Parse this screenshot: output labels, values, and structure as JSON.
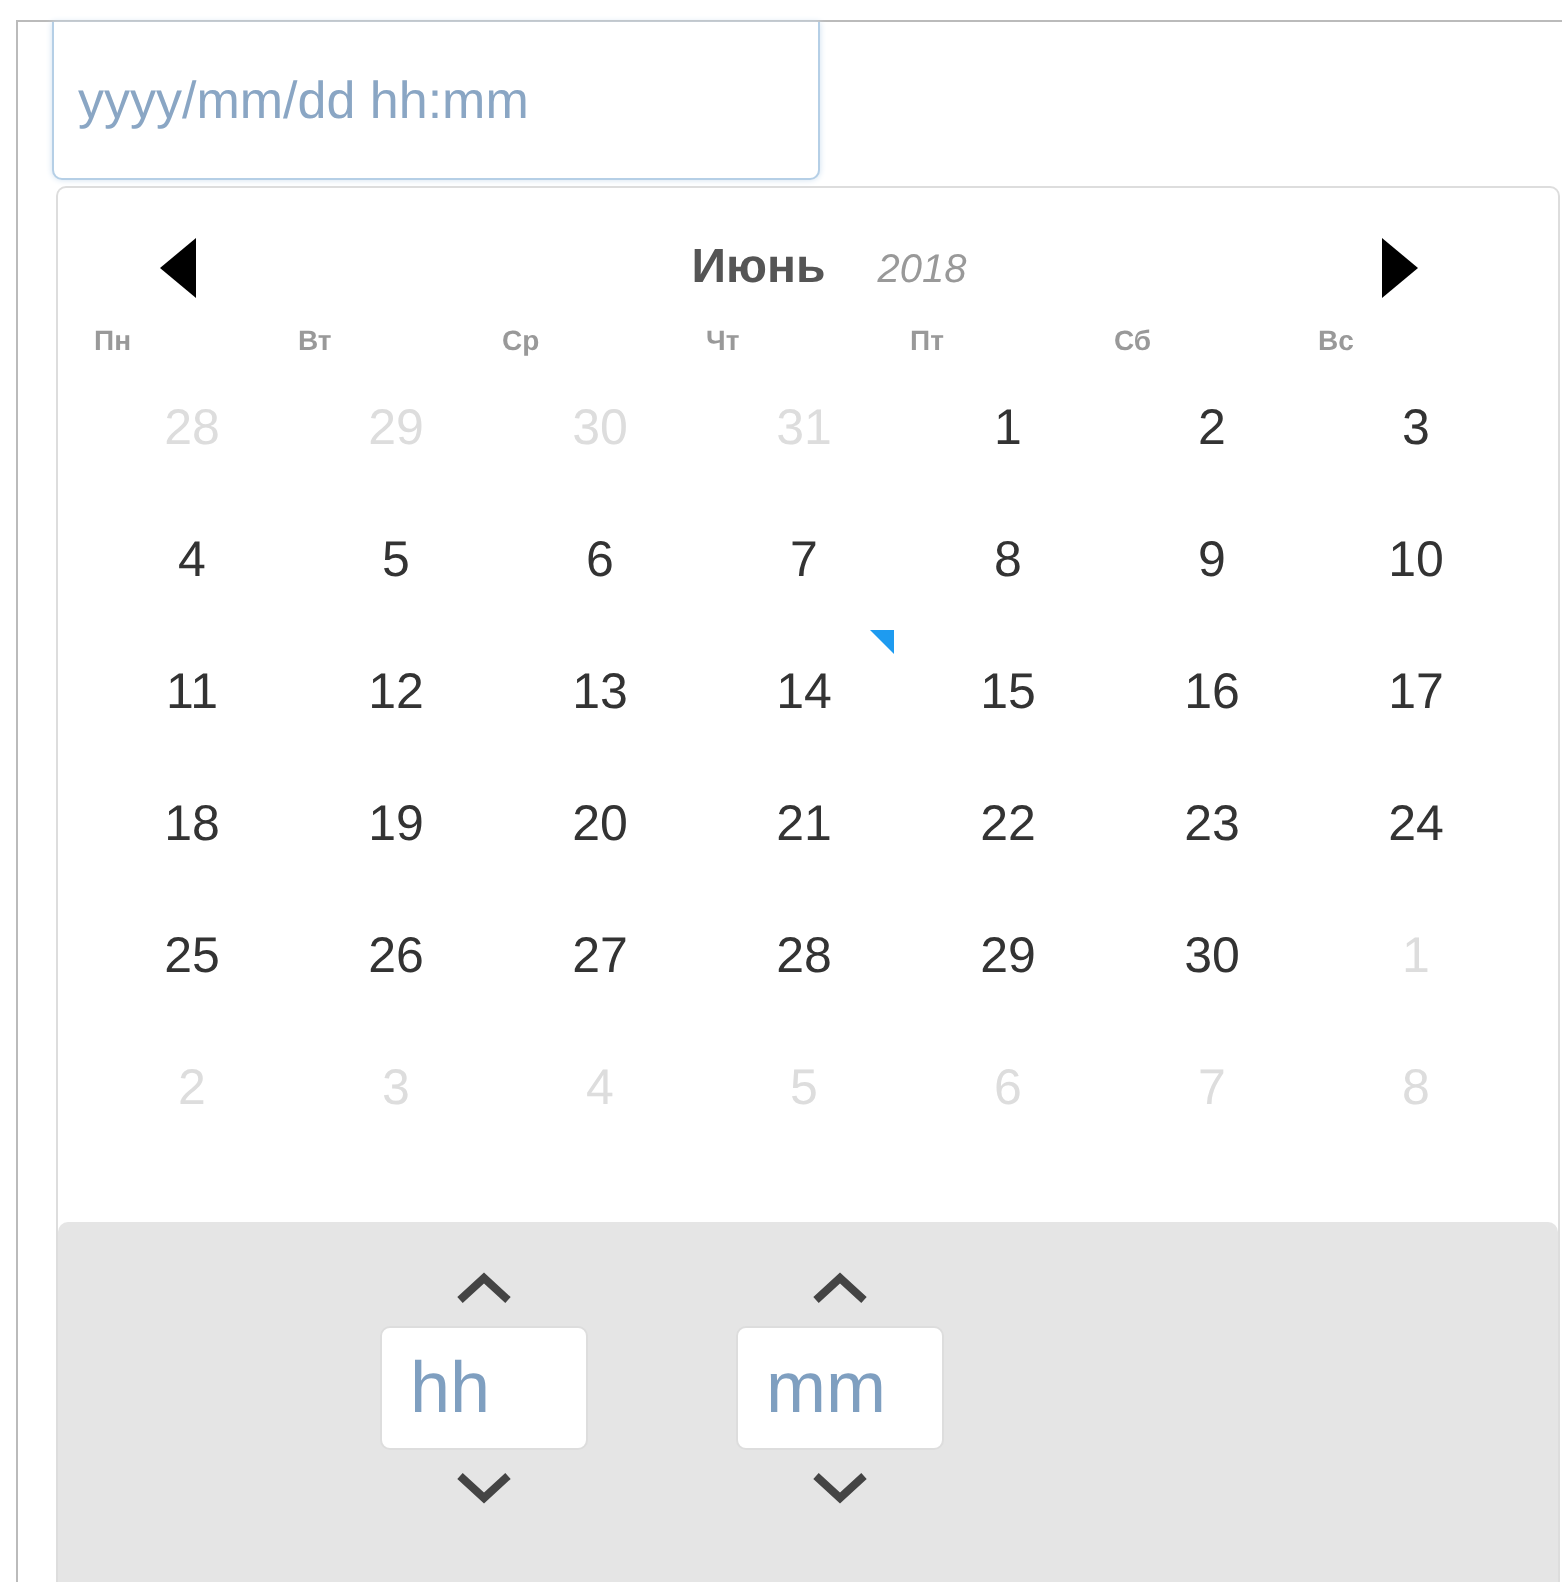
{
  "date_field": {
    "placeholder": "yyyy/mm/dd hh:mm"
  },
  "calendar": {
    "month": "Июнь",
    "year": "2018",
    "weekdays": [
      "Пн",
      "Вт",
      "Ср",
      "Чт",
      "Пт",
      "Сб",
      "Вс"
    ],
    "weeks": [
      [
        {
          "day": "28",
          "outside": true,
          "today": false
        },
        {
          "day": "29",
          "outside": true,
          "today": false
        },
        {
          "day": "30",
          "outside": true,
          "today": false
        },
        {
          "day": "31",
          "outside": true,
          "today": false
        },
        {
          "day": "1",
          "outside": false,
          "today": false
        },
        {
          "day": "2",
          "outside": false,
          "today": false
        },
        {
          "day": "3",
          "outside": false,
          "today": false
        }
      ],
      [
        {
          "day": "4",
          "outside": false,
          "today": false
        },
        {
          "day": "5",
          "outside": false,
          "today": false
        },
        {
          "day": "6",
          "outside": false,
          "today": false
        },
        {
          "day": "7",
          "outside": false,
          "today": false
        },
        {
          "day": "8",
          "outside": false,
          "today": false
        },
        {
          "day": "9",
          "outside": false,
          "today": false
        },
        {
          "day": "10",
          "outside": false,
          "today": false
        }
      ],
      [
        {
          "day": "11",
          "outside": false,
          "today": false
        },
        {
          "day": "12",
          "outside": false,
          "today": false
        },
        {
          "day": "13",
          "outside": false,
          "today": false
        },
        {
          "day": "14",
          "outside": false,
          "today": true
        },
        {
          "day": "15",
          "outside": false,
          "today": false
        },
        {
          "day": "16",
          "outside": false,
          "today": false
        },
        {
          "day": "17",
          "outside": false,
          "today": false
        }
      ],
      [
        {
          "day": "18",
          "outside": false,
          "today": false
        },
        {
          "day": "19",
          "outside": false,
          "today": false
        },
        {
          "day": "20",
          "outside": false,
          "today": false
        },
        {
          "day": "21",
          "outside": false,
          "today": false
        },
        {
          "day": "22",
          "outside": false,
          "today": false
        },
        {
          "day": "23",
          "outside": false,
          "today": false
        },
        {
          "day": "24",
          "outside": false,
          "today": false
        }
      ],
      [
        {
          "day": "25",
          "outside": false,
          "today": false
        },
        {
          "day": "26",
          "outside": false,
          "today": false
        },
        {
          "day": "27",
          "outside": false,
          "today": false
        },
        {
          "day": "28",
          "outside": false,
          "today": false
        },
        {
          "day": "29",
          "outside": false,
          "today": false
        },
        {
          "day": "30",
          "outside": false,
          "today": false
        },
        {
          "day": "1",
          "outside": true,
          "today": false
        }
      ],
      [
        {
          "day": "2",
          "outside": true,
          "today": false
        },
        {
          "day": "3",
          "outside": true,
          "today": false
        },
        {
          "day": "4",
          "outside": true,
          "today": false
        },
        {
          "day": "5",
          "outside": true,
          "today": false
        },
        {
          "day": "6",
          "outside": true,
          "today": false
        },
        {
          "day": "7",
          "outside": true,
          "today": false
        },
        {
          "day": "8",
          "outside": true,
          "today": false
        }
      ]
    ]
  },
  "time": {
    "hour_placeholder": "hh",
    "minute_placeholder": "mm"
  }
}
